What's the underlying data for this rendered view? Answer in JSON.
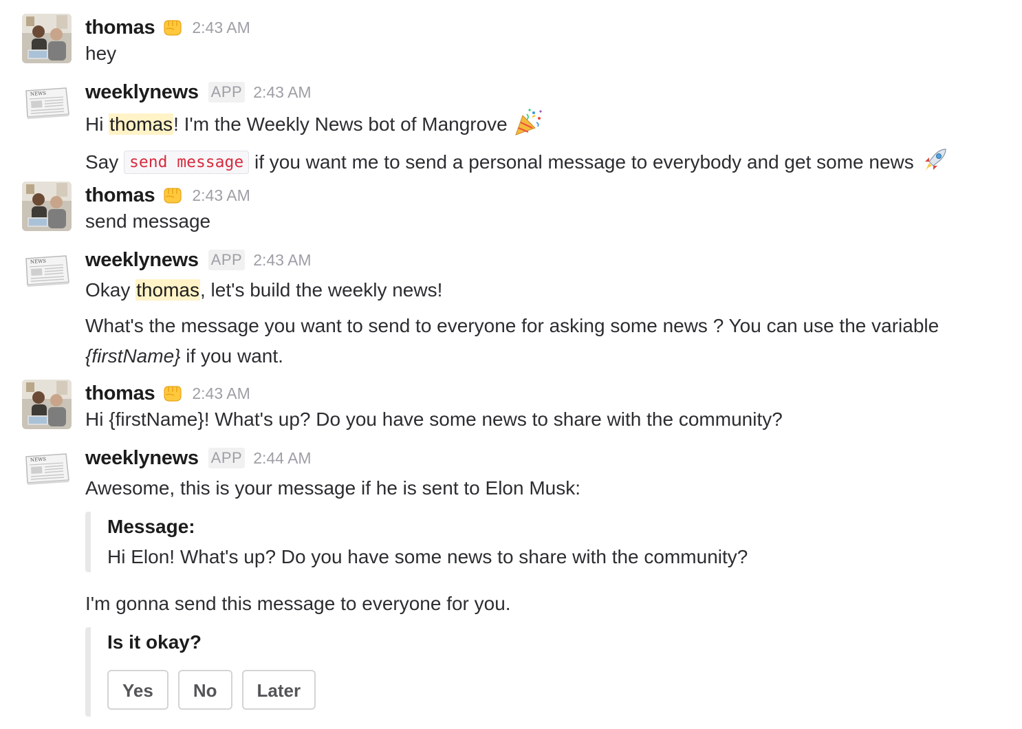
{
  "messages": [
    {
      "author": "thomas",
      "time": "2:43 AM",
      "text": "hey"
    },
    {
      "author": "weeklynews",
      "badge": "APP",
      "time": "2:43 AM",
      "line1": {
        "prefix": "Hi ",
        "mention": "thomas",
        "suffix": "! I'm the Weekly News bot of Mangrove"
      },
      "line2": {
        "prefix": "Say ",
        "code": "send message",
        "suffix": " if you want me to send a personal message to everybody and get some news"
      }
    },
    {
      "author": "thomas",
      "time": "2:43 AM",
      "text": "send message"
    },
    {
      "author": "weeklynews",
      "badge": "APP",
      "time": "2:43 AM",
      "line1": {
        "prefix": "Okay ",
        "mention": "thomas",
        "suffix": ", let's build the weekly news!"
      },
      "para": {
        "prefix": "What's the message you want to send to everyone for asking some news ? You can use the variable ",
        "variable": "{firstName}",
        "suffix": " if you want."
      }
    },
    {
      "author": "thomas",
      "time": "2:43 AM",
      "text": "Hi {firstName}! What's up? Do you have some news to share with the community?"
    },
    {
      "author": "weeklynews",
      "badge": "APP",
      "time": "2:44 AM",
      "text": "Awesome, this is your message if he is sent to Elon Musk:",
      "attachment": {
        "title": "Message:",
        "text": "Hi Elon! What's up? Do you have some news to share with the community?"
      },
      "after_text": "I'm gonna send this message to everyone for you.",
      "question": {
        "title": "Is it okay?",
        "buttons": [
          "Yes",
          "No",
          "Later"
        ]
      }
    }
  ],
  "bot_avatar_label": "NEWS",
  "colors": {
    "mention_bg": "#fff3c7",
    "code_text": "#d72b3f",
    "timestamp": "#9e9ea6",
    "attachment_border": "#e8e8e8"
  }
}
